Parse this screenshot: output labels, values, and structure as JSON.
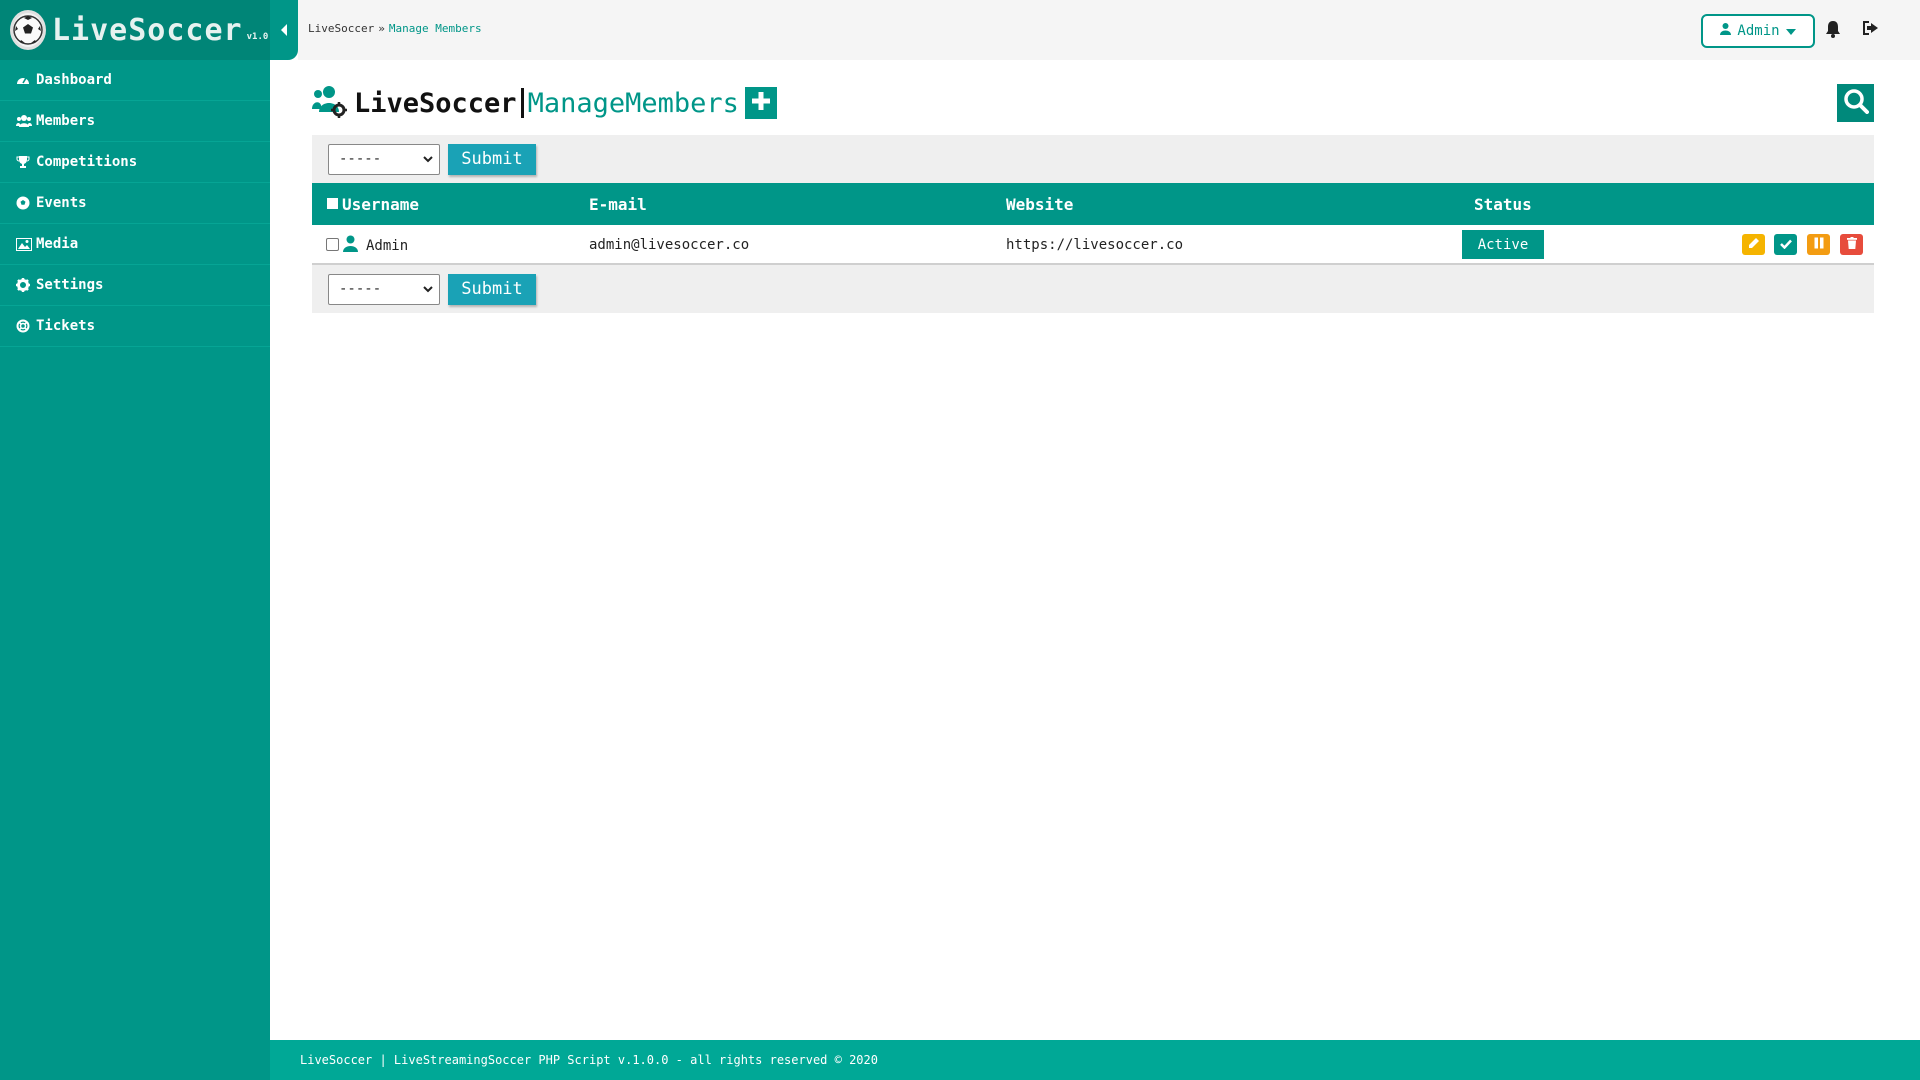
{
  "brand": {
    "name": "LiveSoccer",
    "version": "v1.0.0",
    "accent": "#009688"
  },
  "sidebar": {
    "items": [
      {
        "label": "Dashboard",
        "icon": "dashboard-icon"
      },
      {
        "label": "Members",
        "icon": "users-icon"
      },
      {
        "label": "Competitions",
        "icon": "trophy-icon"
      },
      {
        "label": "Events",
        "icon": "soccer-ball-icon"
      },
      {
        "label": "Media",
        "icon": "image-icon"
      },
      {
        "label": "Settings",
        "icon": "gear-icon"
      },
      {
        "label": "Tickets",
        "icon": "support-icon"
      }
    ]
  },
  "topbar": {
    "breadcrumb": {
      "root": "LiveSoccer",
      "separator": "»",
      "current": "Manage Members"
    },
    "user_label": "Admin"
  },
  "page": {
    "site_title": "LiveSoccer",
    "page_title": "ManageMembers"
  },
  "bulk": {
    "selected": "-----",
    "submit_label": "Submit"
  },
  "table": {
    "headers": {
      "username": "Username",
      "email": "E-mail",
      "website": "Website",
      "status": "Status"
    },
    "rows": [
      {
        "username": "Admin",
        "email": "admin@livesoccer.co",
        "website": "https://livesoccer.co",
        "status": "Active"
      }
    ],
    "action_colors": {
      "edit": "#f5b400",
      "approve": "#009688",
      "suspend": "#f39c12",
      "delete": "#e74c3c"
    }
  },
  "footer": {
    "text": "LiveSoccer | LiveStreamingSoccer PHP Script v.1.0.0 - all rights reserved © 2020"
  }
}
